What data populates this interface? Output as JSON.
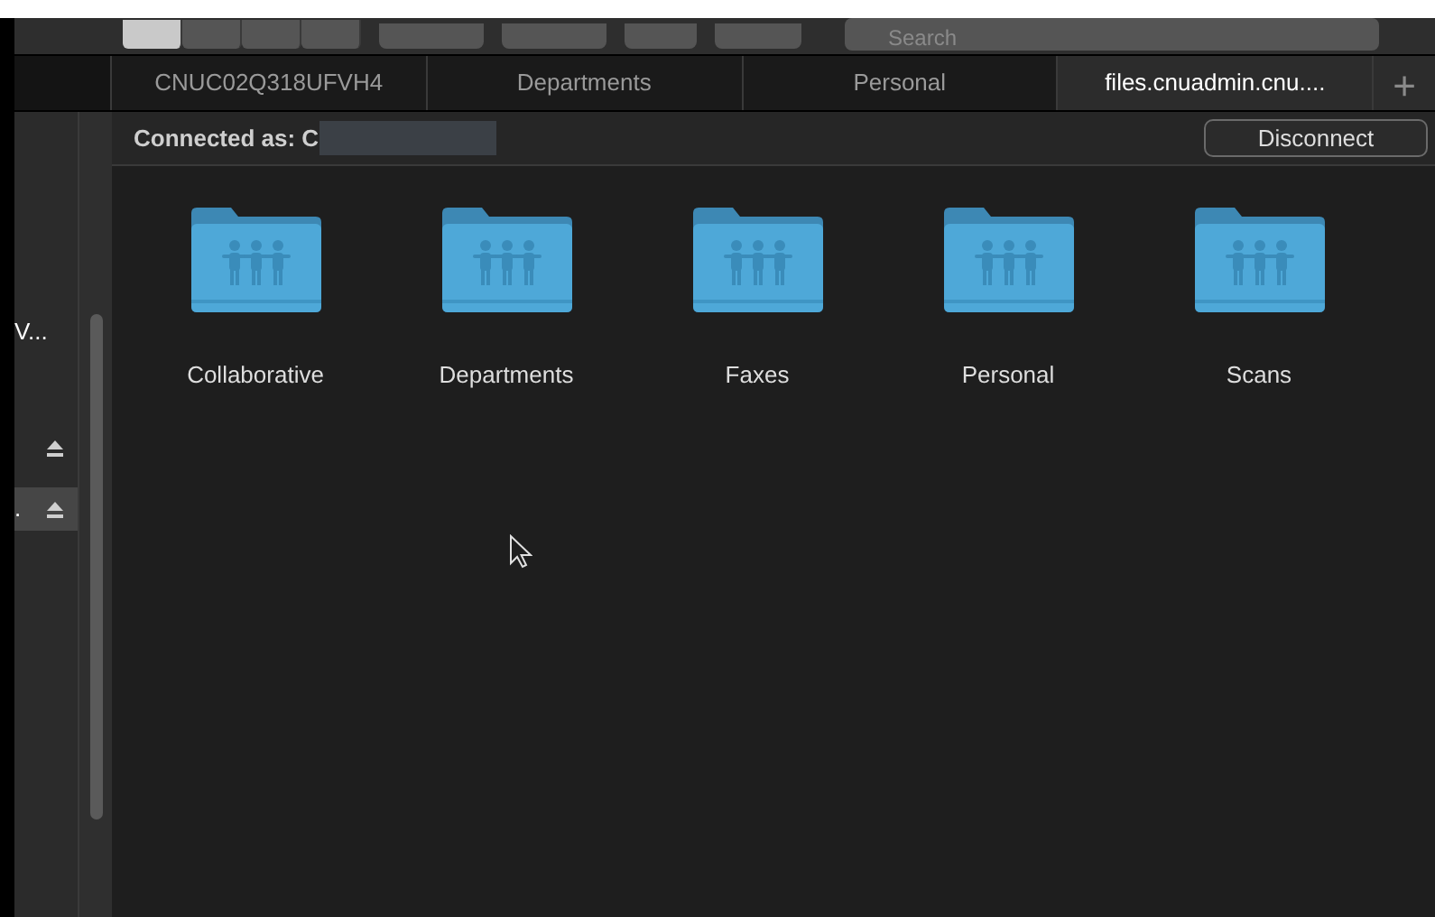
{
  "toolbar": {
    "view_modes": [
      {
        "selected": true
      },
      {
        "selected": false
      },
      {
        "selected": false
      },
      {
        "selected": false
      }
    ],
    "search": {
      "placeholder": "Search"
    }
  },
  "tabs": [
    {
      "label": "CNUC02Q318UFVH4",
      "selected": false
    },
    {
      "label": "Departments",
      "selected": false
    },
    {
      "label": "Personal",
      "selected": false
    },
    {
      "label": "files.cnuadmin.cnu....",
      "selected": true
    }
  ],
  "new_tab": "+",
  "sidebar": {
    "items": [
      {
        "label": "V...",
        "ejectable": false,
        "selected": false
      },
      {
        "ejectable": true,
        "selected": false
      },
      {
        "label": ".",
        "ejectable": true,
        "selected": true
      }
    ]
  },
  "connection": {
    "label": "Connected as: C",
    "button": "Disconnect"
  },
  "folders": [
    {
      "name": "Collaborative"
    },
    {
      "name": "Departments"
    },
    {
      "name": "Faxes"
    },
    {
      "name": "Personal"
    },
    {
      "name": "Scans"
    }
  ]
}
